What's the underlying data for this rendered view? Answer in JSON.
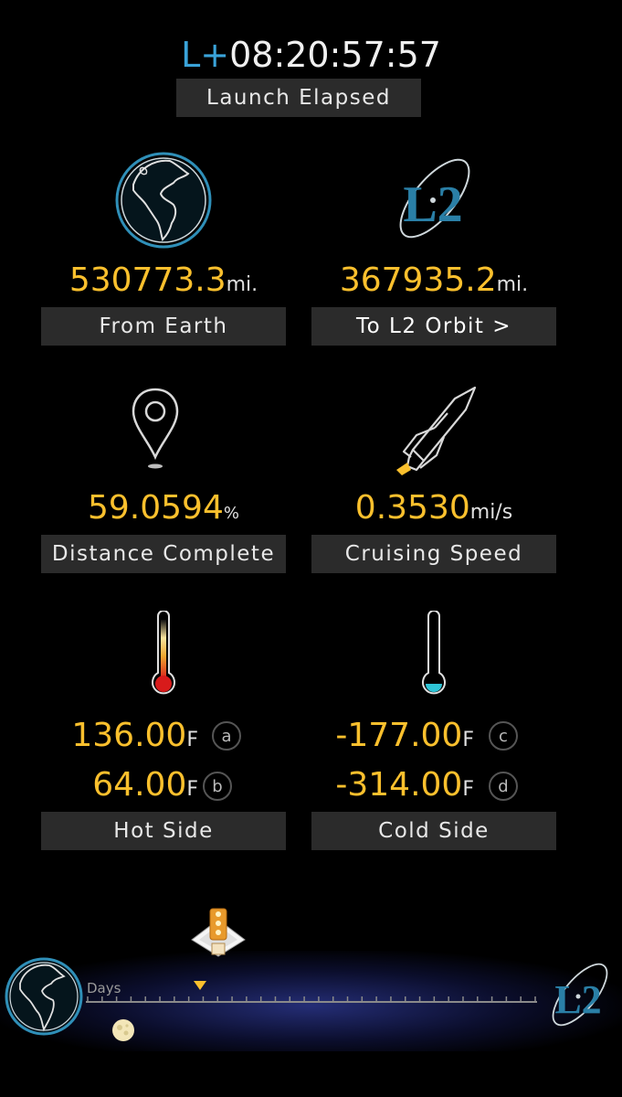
{
  "header": {
    "prefix": "L+",
    "elapsed": "08:20:57:57",
    "label": "Launch Elapsed"
  },
  "stats": {
    "from_earth": {
      "value": "530773.3",
      "unit": "mi.",
      "label": "From Earth",
      "icon": "earth-icon"
    },
    "to_l2": {
      "value": "367935.2",
      "unit": "mi.",
      "label": "To L2 Orbit >",
      "icon": "l2-logo-icon"
    },
    "distance_complete": {
      "value": "59.0594",
      "unit": "%",
      "label": "Distance Complete",
      "icon": "map-pin-icon"
    },
    "cruising_speed": {
      "value": "0.3530",
      "unit": "mi/s",
      "label": "Cruising Speed",
      "icon": "rocket-icon"
    }
  },
  "temps": {
    "hot": {
      "label": "Hot Side",
      "a": {
        "value": "136.00",
        "unit": "F",
        "tag": "a"
      },
      "b": {
        "value": "64.00",
        "unit": "F",
        "tag": "b"
      }
    },
    "cold": {
      "label": "Cold Side",
      "c": {
        "value": "-177.00",
        "unit": "F",
        "tag": "c"
      },
      "d": {
        "value": "-314.00",
        "unit": "F",
        "tag": "d"
      }
    }
  },
  "timeline": {
    "days_label": "Days",
    "progress": 0.25,
    "tick_count": 32
  },
  "colors": {
    "accent_blue": "#3aa3d9",
    "value_yellow": "#fbc02d",
    "hot_red": "#d81b1b",
    "cold_cyan": "#2ec4d6"
  }
}
